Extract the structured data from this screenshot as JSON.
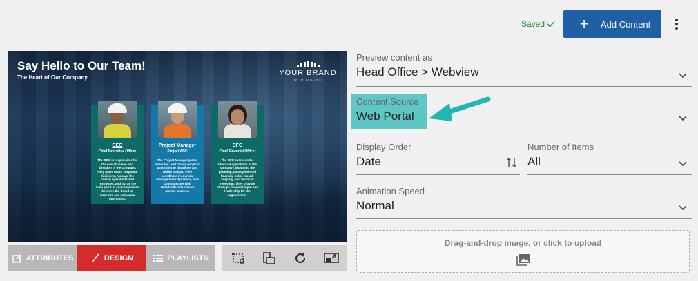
{
  "header": {
    "saved_label": "Saved",
    "add_content_label": "Add Content",
    "accent_color": "#1f5fa5"
  },
  "preview": {
    "title": "Say Hello to Our Team!",
    "subtitle": "The Heart of Our Company",
    "brand_name": "YOUR BRAND",
    "brand_tagline": "WITH TAGLINE",
    "cards": [
      {
        "role": "CEO",
        "subrole": "Chief Executive Officer",
        "description": "The CEO is responsible for the overall vision and direction of the company. They make major corporate decisions, manage the overall operations and resources, and act as the main point of communication between the board of directors and corporate operations."
      },
      {
        "role": "Project Manager",
        "subrole": "Project ABC",
        "description": "The Project Manager plans, executes, and closes projects according to deadlines and within budget. They coordinate resources, manage team dynamics, and communicate with stakeholders to ensure project success."
      },
      {
        "role": "CFO",
        "subrole": "Chief Financial Officer",
        "description": "The CFO oversees the financial operations of the company, including the planning, management of financial risks, record-keeping, and financial reporting. They provide strategic financial input and leadership for the organization."
      }
    ]
  },
  "toolbar": {
    "tabs": [
      {
        "label": "ATTRIBUTES",
        "icon": "edit-icon"
      },
      {
        "label": "DESIGN",
        "icon": "brush-icon",
        "active": true
      },
      {
        "label": "PLAYLISTS",
        "icon": "list-icon"
      }
    ],
    "active_tab_color": "#d62b2b",
    "tools": [
      "crop-frame-icon",
      "resize-icon",
      "refresh-icon",
      "cast-icon"
    ]
  },
  "form": {
    "preview_as": {
      "label": "Preview content as",
      "value": "Head Office > Webview"
    },
    "content_source": {
      "label": "Content Source",
      "value": "Web Portal",
      "highlight_color": "#5fc7c3"
    },
    "display_order": {
      "label": "Display Order",
      "value": "Date"
    },
    "number_of_items": {
      "label": "Number of Items",
      "value": "All"
    },
    "animation_speed": {
      "label": "Animation Speed",
      "value": "Normal"
    },
    "upload": {
      "label": "Drag-and-drop image, or click to upload"
    }
  }
}
